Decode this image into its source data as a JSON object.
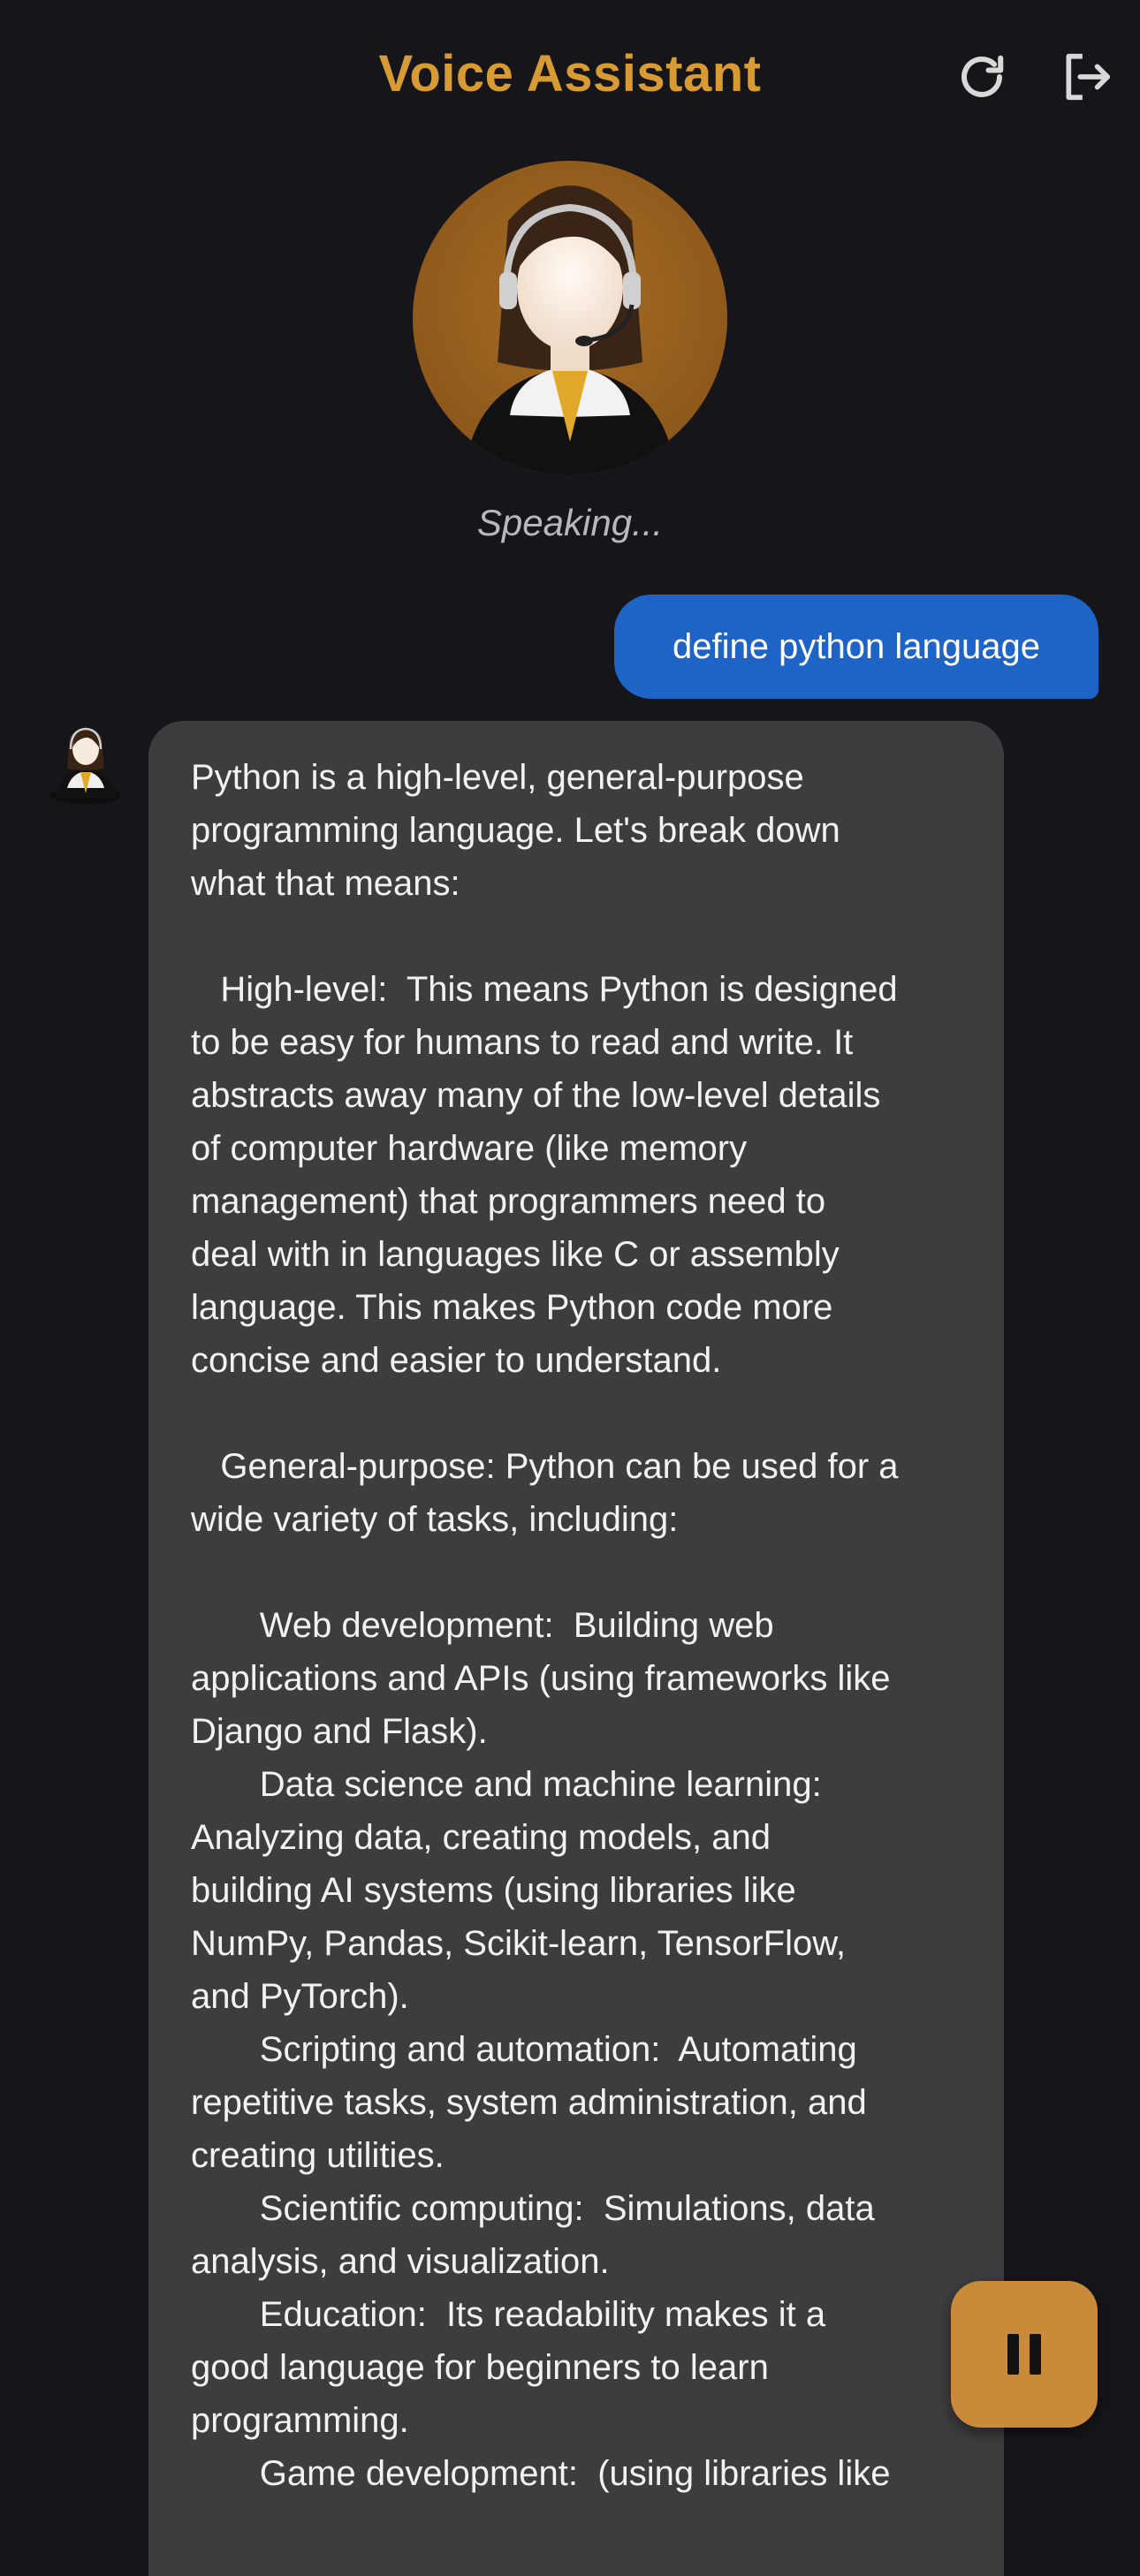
{
  "header": {
    "title": "Voice Assistant",
    "refresh_icon": "refresh-icon",
    "logout_icon": "logout-icon",
    "title_color": "#d89b33"
  },
  "assistant_status": "Speaking...",
  "conversation": {
    "user_message": "define python language",
    "assistant_message": "Python is a high-level, general-purpose\nprogramming language. Let's break down\nwhat that means:\n\n   High-level:  This means Python is designed\nto be easy for humans to read and write. It\nabstracts away many of the low-level details\nof computer hardware (like memory\nmanagement) that programmers need to\ndeal with in languages like C or assembly\nlanguage. This makes Python code more\nconcise and easier to understand.\n\n   General-purpose: Python can be used for a\nwide variety of tasks, including:\n\n       Web development:  Building web\napplications and APIs (using frameworks like\nDjango and Flask).\n       Data science and machine learning:\nAnalyzing data, creating models, and\nbuilding AI systems (using libraries like\nNumPy, Pandas, Scikit-learn, TensorFlow,\nand PyTorch).\n       Scripting and automation:  Automating\nrepetitive tasks, system administration, and\ncreating utilities.\n       Scientific computing:  Simulations, data\nanalysis, and visualization.\n       Education:  Its readability makes it a\ngood language for beginners to learn\nprogramming.\n       Game development:  (using libraries like"
  },
  "controls": {
    "pause_icon": "pause-icon"
  },
  "colors": {
    "background": "#16161a",
    "accent": "#d89b33",
    "user_bubble": "#1e63c6",
    "assistant_bubble": "#3d3d3f",
    "fab": "#c98b3a"
  }
}
